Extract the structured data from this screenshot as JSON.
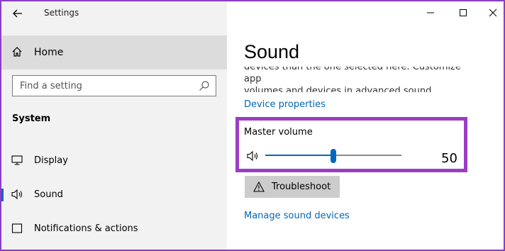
{
  "window": {
    "title": "Settings",
    "controls": [
      "minimize-icon",
      "maximize-icon",
      "close-icon"
    ]
  },
  "sidebar": {
    "back_icon": "back-arrow-icon",
    "home": {
      "label": "Home",
      "icon": "home-icon"
    },
    "search": {
      "placeholder": "Find a setting",
      "icon": "search-icon"
    },
    "section_title": "System",
    "items": [
      {
        "label": "Display",
        "icon": "monitor-icon",
        "active": false
      },
      {
        "label": "Sound",
        "icon": "speaker-icon",
        "active": true
      },
      {
        "label": "Notifications & actions",
        "icon": "notification-icon",
        "active": false
      }
    ]
  },
  "main": {
    "title": "Sound",
    "description_line1": "devices than the one selected here. Customize app",
    "description_line2": "volumes and devices in advanced sound options.",
    "device_properties_link": "Device properties",
    "master_volume": {
      "label": "Master volume",
      "value": 50,
      "value_text": "50",
      "icon": "speaker-icon"
    },
    "troubleshoot_button": {
      "label": "Troubleshoot",
      "icon": "warning-icon"
    },
    "manage_devices_link": "Manage sound devices"
  },
  "colors": {
    "accent": "#0067c0",
    "link": "#0067b8",
    "highlight_box": "#9b3dc6",
    "sidebar_bg": "#f2f2f2",
    "selected_bg": "#dcdcdc"
  }
}
